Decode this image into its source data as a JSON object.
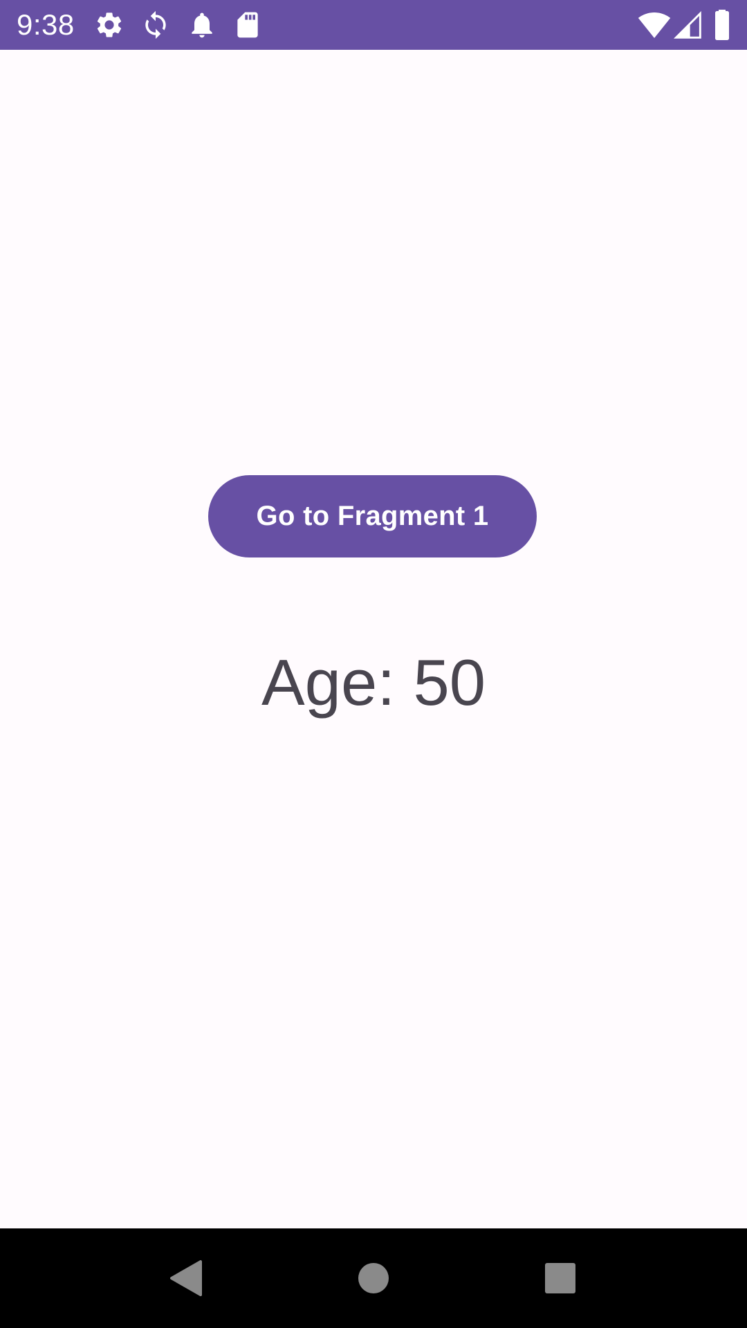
{
  "status_bar": {
    "time": "9:38",
    "background_color": "#6750A4",
    "icons_left": [
      "settings-icon",
      "sync-icon",
      "notification-bell-icon",
      "sd-card-icon"
    ],
    "icons_right": [
      "wifi-icon",
      "cellular-signal-icon",
      "battery-icon"
    ]
  },
  "main": {
    "button_label": "Go to Fragment 1",
    "age_text": "Age: 50",
    "accent_color": "#6750A4",
    "text_color": "#49454F",
    "background_color": "#FFFBFE"
  },
  "nav_bar": {
    "buttons": [
      "back-icon",
      "home-icon",
      "recents-icon"
    ],
    "background_color": "#000000"
  }
}
